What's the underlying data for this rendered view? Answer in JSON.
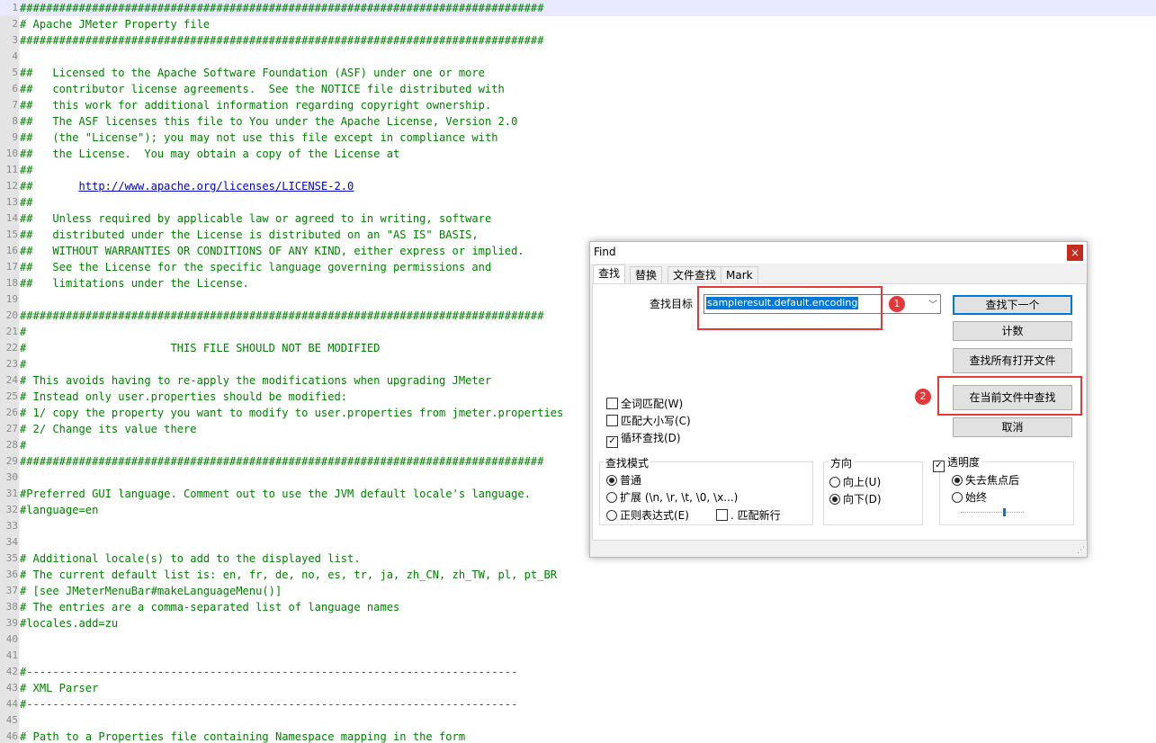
{
  "editor": {
    "lines": [
      {
        "n": "1",
        "text": "################################################################################",
        "current": true
      },
      {
        "n": "2",
        "text": "# Apache JMeter Property file"
      },
      {
        "n": "3",
        "text": "################################################################################"
      },
      {
        "n": "4",
        "text": ""
      },
      {
        "n": "5",
        "text": "##   Licensed to the Apache Software Foundation (ASF) under one or more"
      },
      {
        "n": "6",
        "text": "##   contributor license agreements.  See the NOTICE file distributed with"
      },
      {
        "n": "7",
        "text": "##   this work for additional information regarding copyright ownership."
      },
      {
        "n": "8",
        "text": "##   The ASF licenses this file to You under the Apache License, Version 2.0"
      },
      {
        "n": "9",
        "text": "##   (the \"License\"); you may not use this file except in compliance with"
      },
      {
        "n": "10",
        "text": "##   the License.  You may obtain a copy of the License at"
      },
      {
        "n": "11",
        "text": "##"
      },
      {
        "n": "12",
        "text": "##       ",
        "url": "http://www.apache.org/licenses/LICENSE-2.0"
      },
      {
        "n": "13",
        "text": "##"
      },
      {
        "n": "14",
        "text": "##   Unless required by applicable law or agreed to in writing, software"
      },
      {
        "n": "15",
        "text": "##   distributed under the License is distributed on an \"AS IS\" BASIS,"
      },
      {
        "n": "16",
        "text": "##   WITHOUT WARRANTIES OR CONDITIONS OF ANY KIND, either express or implied."
      },
      {
        "n": "17",
        "text": "##   See the License for the specific language governing permissions and"
      },
      {
        "n": "18",
        "text": "##   limitations under the License."
      },
      {
        "n": "19",
        "text": ""
      },
      {
        "n": "20",
        "text": "################################################################################"
      },
      {
        "n": "21",
        "text": "#"
      },
      {
        "n": "22",
        "text": "#                      THIS FILE SHOULD NOT BE MODIFIED"
      },
      {
        "n": "23",
        "text": "#"
      },
      {
        "n": "24",
        "text": "# This avoids having to re-apply the modifications when upgrading JMeter"
      },
      {
        "n": "25",
        "text": "# Instead only user.properties should be modified:"
      },
      {
        "n": "26",
        "text": "# 1/ copy the property you want to modify to user.properties from jmeter.properties"
      },
      {
        "n": "27",
        "text": "# 2/ Change its value there"
      },
      {
        "n": "28",
        "text": "#"
      },
      {
        "n": "29",
        "text": "################################################################################"
      },
      {
        "n": "30",
        "text": ""
      },
      {
        "n": "31",
        "text": "#Preferred GUI language. Comment out to use the JVM default locale's language."
      },
      {
        "n": "32",
        "text": "#language=en"
      },
      {
        "n": "33",
        "text": ""
      },
      {
        "n": "34",
        "text": ""
      },
      {
        "n": "35",
        "text": "# Additional locale(s) to add to the displayed list."
      },
      {
        "n": "36",
        "text": "# The current default list is: en, fr, de, no, es, tr, ja, zh_CN, zh_TW, pl, pt_BR"
      },
      {
        "n": "37",
        "text": "# [see JMeterMenuBar#makeLanguageMenu()]"
      },
      {
        "n": "38",
        "text": "# The entries are a comma-separated list of language names"
      },
      {
        "n": "39",
        "text": "#locales.add=zu"
      },
      {
        "n": "40",
        "text": ""
      },
      {
        "n": "41",
        "text": ""
      },
      {
        "n": "42",
        "text": "#---------------------------------------------------------------------------"
      },
      {
        "n": "43",
        "text": "# XML Parser"
      },
      {
        "n": "44",
        "text": "#---------------------------------------------------------------------------"
      },
      {
        "n": "45",
        "text": ""
      },
      {
        "n": "46",
        "text": "# Path to a Properties file containing Namespace mapping in the form"
      }
    ]
  },
  "find_dialog": {
    "title": "Find",
    "close_glyph": "×",
    "tabs": [
      "查找",
      "替换",
      "文件查找",
      "Mark"
    ],
    "target_label": "查找目标",
    "target_value": "sampleresult.default.encoding",
    "dropdown_glyph": "﹀",
    "badge1": "1",
    "badge2": "2",
    "buttons": {
      "find_next": "查找下一个",
      "count": "计数",
      "find_all_open": "查找所有打开文件",
      "find_in_current": "在当前文件中查找",
      "cancel": "取消"
    },
    "options": {
      "whole_word": "全词匹配(W)",
      "match_case": "匹配大小写(C)",
      "wrap_around": "循环查找(D)"
    },
    "search_mode": {
      "title": "查找模式",
      "normal": "普通",
      "extended": "扩展 (\\n, \\r, \\t, \\0, \\x...)",
      "regex": "正则表达式(E)",
      "dot_newline": ". 匹配新行"
    },
    "direction": {
      "title": "方向",
      "up": "向上(U)",
      "down": "向下(D)"
    },
    "transparency": {
      "title": "透明度",
      "on_lose_focus": "失去焦点后",
      "always": "始终"
    }
  },
  "colors": {
    "comment": "#008000",
    "highlight": "#e5383b",
    "selection": "#0078d7"
  }
}
